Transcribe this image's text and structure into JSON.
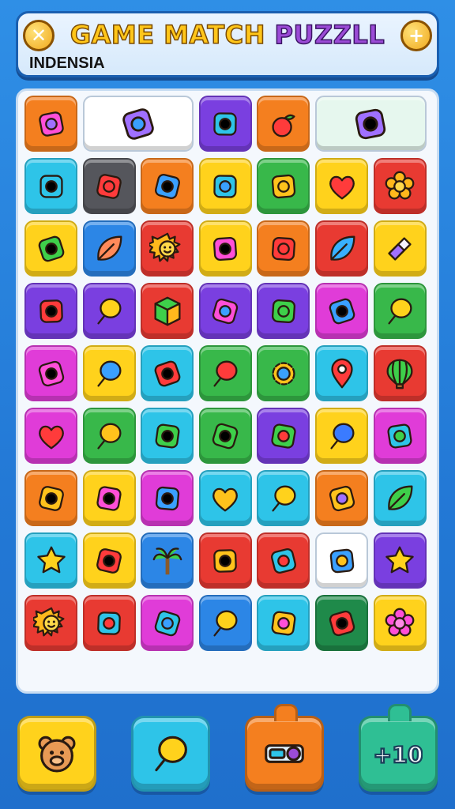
{
  "header": {
    "title_word1": "GAME",
    "title_word2": "MATCH",
    "title_word3": "PUZZLL",
    "subtitle": "INDENSIA",
    "left_button_icon": "close-icon",
    "right_button_icon": "plus-icon"
  },
  "colors": {
    "orange": "#f47f1f",
    "white": "#ffffff",
    "purple": "#7a3fe0",
    "green": "#38b84a",
    "cyan": "#2ec4e8",
    "gray": "#55565c",
    "yellow": "#ffd21c",
    "red": "#e83a32",
    "blue": "#2c86e6",
    "magenta": "#e03cd8",
    "darkgreen": "#1f8a4a",
    "mint": "#e6f7ee"
  },
  "board": {
    "rows": [
      [
        {
          "color": "orange",
          "icon": "glue-icon"
        },
        {
          "color": "white",
          "icon": "scissors-pen-icon",
          "span": 2
        },
        {
          "color": "purple",
          "icon": "jump-rope-icon"
        },
        {
          "color": "orange",
          "icon": "apple-icon"
        },
        {
          "color": "mint",
          "icon": "bottles-icon",
          "span": 2
        }
      ],
      [
        {
          "color": "cyan",
          "icon": "ladybug-icon"
        },
        {
          "color": "gray",
          "icon": "lens-icon"
        },
        {
          "color": "orange",
          "icon": "rocket-icon"
        },
        {
          "color": "yellow",
          "icon": "spear-icon"
        },
        {
          "color": "green",
          "icon": "ice-pop-icon"
        },
        {
          "color": "yellow",
          "icon": "heart-apple-icon"
        },
        {
          "color": "red",
          "icon": "flower-icon"
        }
      ],
      [
        {
          "color": "yellow",
          "icon": "paintbrush-icon"
        },
        {
          "color": "blue",
          "icon": "leaf-icon"
        },
        {
          "color": "red",
          "icon": "sun-icon"
        },
        {
          "color": "yellow",
          "icon": "sticky-note-icon"
        },
        {
          "color": "orange",
          "icon": "crayon-icon"
        },
        {
          "color": "red",
          "icon": "feather-icon"
        },
        {
          "color": "yellow",
          "icon": "eraser-icon"
        }
      ],
      [
        {
          "color": "purple",
          "icon": "flag-icon"
        },
        {
          "color": "purple",
          "icon": "chat-icon"
        },
        {
          "color": "red",
          "icon": "cube-icon"
        },
        {
          "color": "purple",
          "icon": "tape-icon"
        },
        {
          "color": "purple",
          "icon": "folder-icon"
        },
        {
          "color": "magenta",
          "icon": "usb-icon"
        },
        {
          "color": "green",
          "icon": "paddle-icon"
        }
      ],
      [
        {
          "color": "magenta",
          "icon": "dots-icon"
        },
        {
          "color": "yellow",
          "icon": "balloon-icon"
        },
        {
          "color": "cyan",
          "icon": "virus-icon"
        },
        {
          "color": "green",
          "icon": "speech-heart-icon"
        },
        {
          "color": "green",
          "icon": "gear-icon"
        },
        {
          "color": "cyan",
          "icon": "map-pin-icon"
        },
        {
          "color": "red",
          "icon": "hot-air-balloon-icon"
        }
      ],
      [
        {
          "color": "magenta",
          "icon": "bear-heart-icon"
        },
        {
          "color": "green",
          "icon": "bubble-icon"
        },
        {
          "color": "cyan",
          "icon": "robot-icon"
        },
        {
          "color": "green",
          "icon": "shield-icon"
        },
        {
          "color": "purple",
          "icon": "bag-icon"
        },
        {
          "color": "yellow",
          "icon": "magnifier-icon"
        },
        {
          "color": "magenta",
          "icon": "badge-icon"
        }
      ],
      [
        {
          "color": "orange",
          "icon": "battery-icon"
        },
        {
          "color": "yellow",
          "icon": "eye-bubble-icon"
        },
        {
          "color": "magenta",
          "icon": "candy-icon"
        },
        {
          "color": "cyan",
          "icon": "heart-icon"
        },
        {
          "color": "cyan",
          "icon": "lollipop-icon"
        },
        {
          "color": "orange",
          "icon": "notepad-icon"
        },
        {
          "color": "cyan",
          "icon": "branch-icon"
        }
      ],
      [
        {
          "color": "cyan",
          "icon": "star-icon"
        },
        {
          "color": "yellow",
          "icon": "crossed-tools-icon"
        },
        {
          "color": "blue",
          "icon": "palm-tree-icon"
        },
        {
          "color": "red",
          "icon": "chip-icon"
        },
        {
          "color": "red",
          "icon": "glue-stick-icon"
        },
        {
          "color": "white",
          "icon": "shell-icon"
        },
        {
          "color": "purple",
          "icon": "star-icon"
        }
      ],
      [
        {
          "color": "red",
          "icon": "sun-icon"
        },
        {
          "color": "red",
          "icon": "game-box-icon"
        },
        {
          "color": "magenta",
          "icon": "peanut-icon"
        },
        {
          "color": "blue",
          "icon": "lemon-icon"
        },
        {
          "color": "cyan",
          "icon": "brush-icon"
        },
        {
          "color": "darkgreen",
          "icon": "crossed-brushes-icon"
        },
        {
          "color": "yellow",
          "icon": "spiky-flower-icon"
        }
      ]
    ]
  },
  "actions": [
    {
      "name": "bear-button",
      "icon": "bear-icon",
      "color": "#ffd21c"
    },
    {
      "name": "hint-button",
      "icon": "chat-icon",
      "color": "#2ec4e8"
    },
    {
      "name": "shuffle-button",
      "icon": "toggle-icon",
      "color": "#f47f1f",
      "tab": true
    },
    {
      "name": "add-moves-button",
      "icon": "plus-ten-icon",
      "color": "#2fbf94",
      "tab": true
    }
  ]
}
